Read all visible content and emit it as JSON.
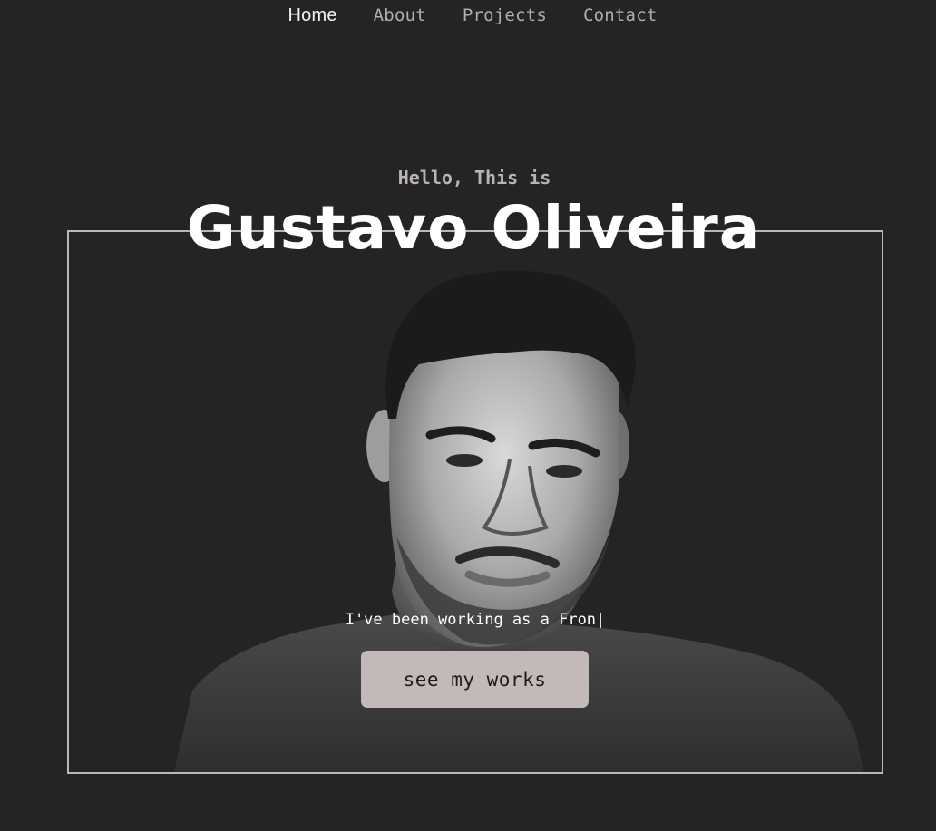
{
  "nav": {
    "items": [
      {
        "label": "Home",
        "active": true
      },
      {
        "label": "About",
        "active": false
      },
      {
        "label": "Projects",
        "active": false
      },
      {
        "label": "Contact",
        "active": false
      }
    ]
  },
  "hero": {
    "greeting": "Hello, This is",
    "name": "Gustavo Oliveira",
    "tagline": "I've been working as a Fron|",
    "cta_label": "see my works"
  },
  "colors": {
    "background": "#242424",
    "frame_border": "#bdb6b3",
    "button_bg": "#c3b9b8",
    "nav_active": "#f3f3f3",
    "nav_inactive": "#b4aca8"
  }
}
